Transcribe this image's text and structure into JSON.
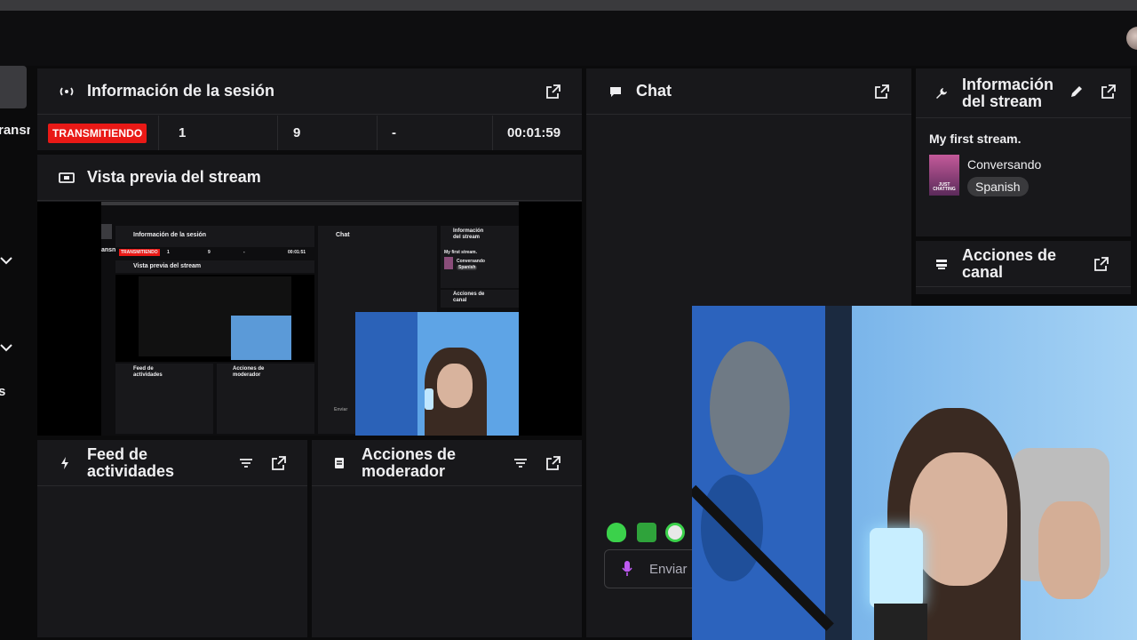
{
  "session": {
    "title": "Información de la sesión",
    "status": "TRANSMITIENDO",
    "viewers": "1",
    "followers": "9",
    "subs": "-",
    "uptime": "00:01:59"
  },
  "preview": {
    "title": "Vista previa del stream",
    "mini_session_title": "Información de la sesión",
    "mini_status": "TRANSMITIENDO",
    "mini_viewers": "1",
    "mini_followers": "9",
    "mini_subs": "-",
    "mini_uptime": "00:01:51",
    "mini_preview_title": "Vista previa del stream",
    "mini_chat": "Chat",
    "mini_info_title": "Información del stream",
    "mini_stream_title": "My first stream.",
    "mini_category": "Conversando",
    "mini_tag": "Spanish",
    "mini_actions": "Acciones de canal",
    "mini_feed": "Feed de actividades",
    "mini_mod": "Acciones de moderador",
    "mini_send": "Enviar",
    "mini_rail_text": "ansn"
  },
  "feed": {
    "title_line1": "Feed de",
    "title_line2": "actividades"
  },
  "moderator": {
    "title_line1": "Acciones de",
    "title_line2": "moderador"
  },
  "chat": {
    "title": "Chat",
    "send_placeholder": "Enviar"
  },
  "stream_info": {
    "title_line1": "Información",
    "title_line2": "del stream",
    "stream_title": "My first stream.",
    "category": "Conversando",
    "category_art_text": "JUST CHATTING",
    "tag": "Spanish"
  },
  "channel_actions": {
    "title_line1": "Acciones de",
    "title_line2": "canal"
  },
  "left_rail": {
    "label": "ransn",
    "label2": "s"
  },
  "colors": {
    "live": "#e91916",
    "panel": "#18181b",
    "background": "#0b0b0c",
    "accent_mic": "#bf5af2"
  }
}
